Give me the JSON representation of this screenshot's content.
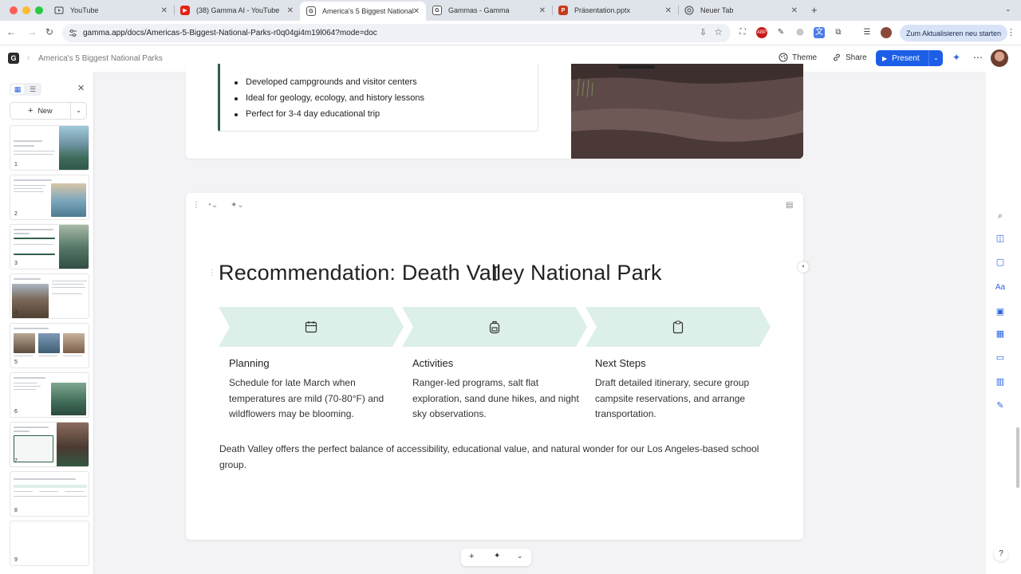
{
  "browser": {
    "tabs": [
      {
        "title": "YouTube",
        "icon": "youtube-icon"
      },
      {
        "title": "(38) Gamma AI - YouTube",
        "icon": "youtube-icon"
      },
      {
        "title": "America's 5 Biggest National",
        "icon": "gamma-icon",
        "active": true
      },
      {
        "title": "Gammas - Gamma",
        "icon": "gamma-icon"
      },
      {
        "title": "Präsentation.pptx",
        "icon": "powerpoint-icon"
      },
      {
        "title": "Neuer Tab",
        "icon": "chrome-icon"
      }
    ],
    "new_tab": "+",
    "url": "gamma.app/docs/Americas-5-Biggest-National-Parks-r0q04gi4m19l064?mode=doc",
    "update_button": "Zum Aktualisieren neu starten"
  },
  "app": {
    "logo": "G",
    "doc_title": "America's 5 Biggest National Parks",
    "theme_label": "Theme",
    "share_label": "Share",
    "present_label": "Present"
  },
  "sidepanel": {
    "new_label": "New",
    "slides": [
      {
        "num": "1",
        "title": "America's 5 Biggest National Parks"
      },
      {
        "num": "2",
        "title": "Introduction"
      },
      {
        "num": "3",
        "title": "Gates of the Arctic National Park (Alaska)"
      },
      {
        "num": "4",
        "title": "Denali National Park"
      },
      {
        "num": "5",
        "title": "Katmai National Park (Alaska)"
      },
      {
        "num": "6",
        "title": "Death Valley National Park"
      },
      {
        "num": "7",
        "title": "Comparing Options for Our LA School Trip"
      },
      {
        "num": "8",
        "title": "Recommendation: Death Valley National Park"
      },
      {
        "num": "9",
        "title": ""
      }
    ]
  },
  "top_card": {
    "bullets": [
      "Developed campgrounds and visitor centers",
      "Ideal for geology, ecology, and history lessons",
      "Perfect for 3-4 day educational trip"
    ]
  },
  "slide": {
    "title": "Recommendation: Death Valley National Park",
    "columns": [
      {
        "icon": "calendar-icon",
        "title": "Planning",
        "body": "Schedule for late March when temperatures are mild (70-80°F) and wildflowers may be blooming."
      },
      {
        "icon": "backpack-icon",
        "title": "Activities",
        "body": "Ranger-led programs, salt flat exploration, sand dune hikes, and night sky observations."
      },
      {
        "icon": "clipboard-icon",
        "title": "Next Steps",
        "body": "Draft detailed itinerary, secure group campsite reservations, and arrange transportation."
      }
    ],
    "conclusion": "Death Valley offers the perfect balance of accessibility, educational value, and natural wonder for our Los Angeles-based school group."
  },
  "colors": {
    "accent": "#1d5ee6",
    "chevron_fill": "#dcefe8",
    "border_accent": "#2f5f4a"
  },
  "help_label": "?"
}
